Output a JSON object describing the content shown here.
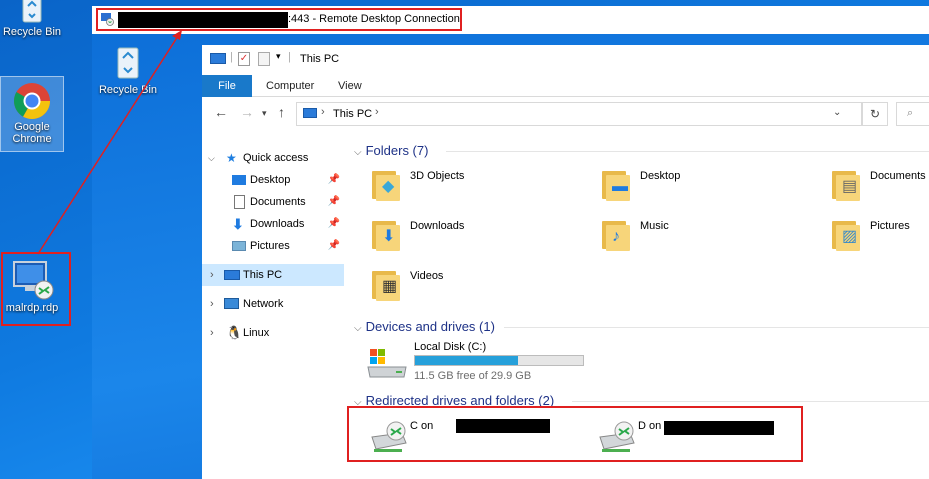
{
  "desktop": {
    "icons": [
      {
        "label": "Recycle Bin"
      },
      {
        "label": "Google Chrome"
      },
      {
        "label": "malrdp.rdp"
      }
    ]
  },
  "rdp": {
    "title_suffix": ":443 - Remote Desktop Connection",
    "inner_desktop": {
      "recycle_label": "Recycle Bin"
    }
  },
  "explorer": {
    "qat_title": "This PC",
    "ribbon_tabs": [
      "File",
      "Computer",
      "View"
    ],
    "address_location": "This PC",
    "nav": {
      "quick_access": "Quick access",
      "items": [
        "Desktop",
        "Documents",
        "Downloads",
        "Pictures"
      ],
      "this_pc": "This PC",
      "network": "Network",
      "linux": "Linux"
    },
    "groups": {
      "folders": "Folders (7)",
      "devices": "Devices and drives (1)",
      "redirected": "Redirected drives and folders (2)"
    },
    "folders": [
      "3D Objects",
      "Desktop",
      "Documents",
      "Downloads",
      "Music",
      "Pictures",
      "Videos"
    ],
    "drive": {
      "name": "Local Disk (C:)",
      "free_text": "11.5 GB free of 29.9 GB",
      "used_fraction": 0.615
    },
    "redirected": [
      {
        "label": "C on"
      },
      {
        "label": "D on"
      }
    ]
  },
  "colors": {
    "annotation_red": "#e02020",
    "selection": "#cce8ff",
    "drive_bar": "#26a0da"
  }
}
